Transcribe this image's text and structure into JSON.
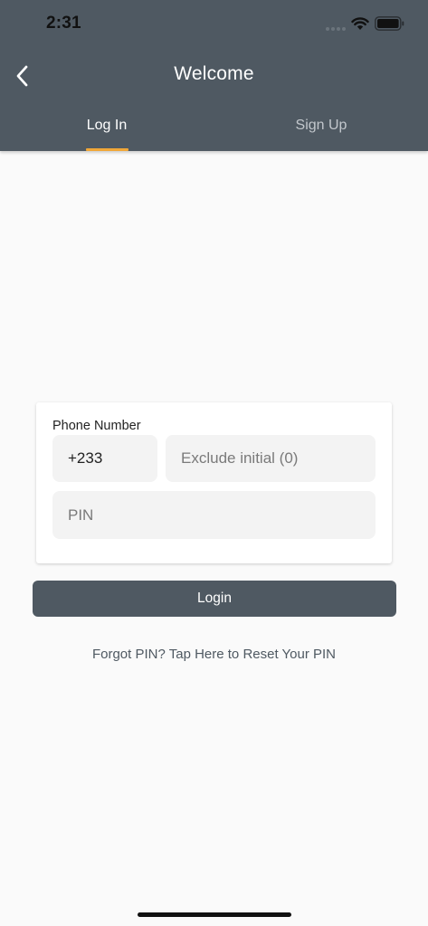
{
  "status_bar": {
    "time": "2:31",
    "icons": [
      "cellular-signal-icon",
      "wifi-icon",
      "battery-icon"
    ]
  },
  "header": {
    "title": "Welcome",
    "back_icon": "chevron-left-icon",
    "tabs": [
      {
        "label": "Log In",
        "active": true
      },
      {
        "label": "Sign Up",
        "active": false
      }
    ]
  },
  "login_form": {
    "phone_label": "Phone Number",
    "country_code_value": "+233",
    "phone_placeholder": "Exclude initial (0)",
    "pin_placeholder": "PIN"
  },
  "login_button_label": "Login",
  "forgot_link": "Forgot PIN? Tap Here to Reset Your PIN",
  "colors": {
    "header_bg": "#4f5962",
    "tab_indicator": "#f0a738",
    "page_bg": "#fafafa",
    "field_bg": "#f3f3f3",
    "button_bg": "#4f5962"
  }
}
